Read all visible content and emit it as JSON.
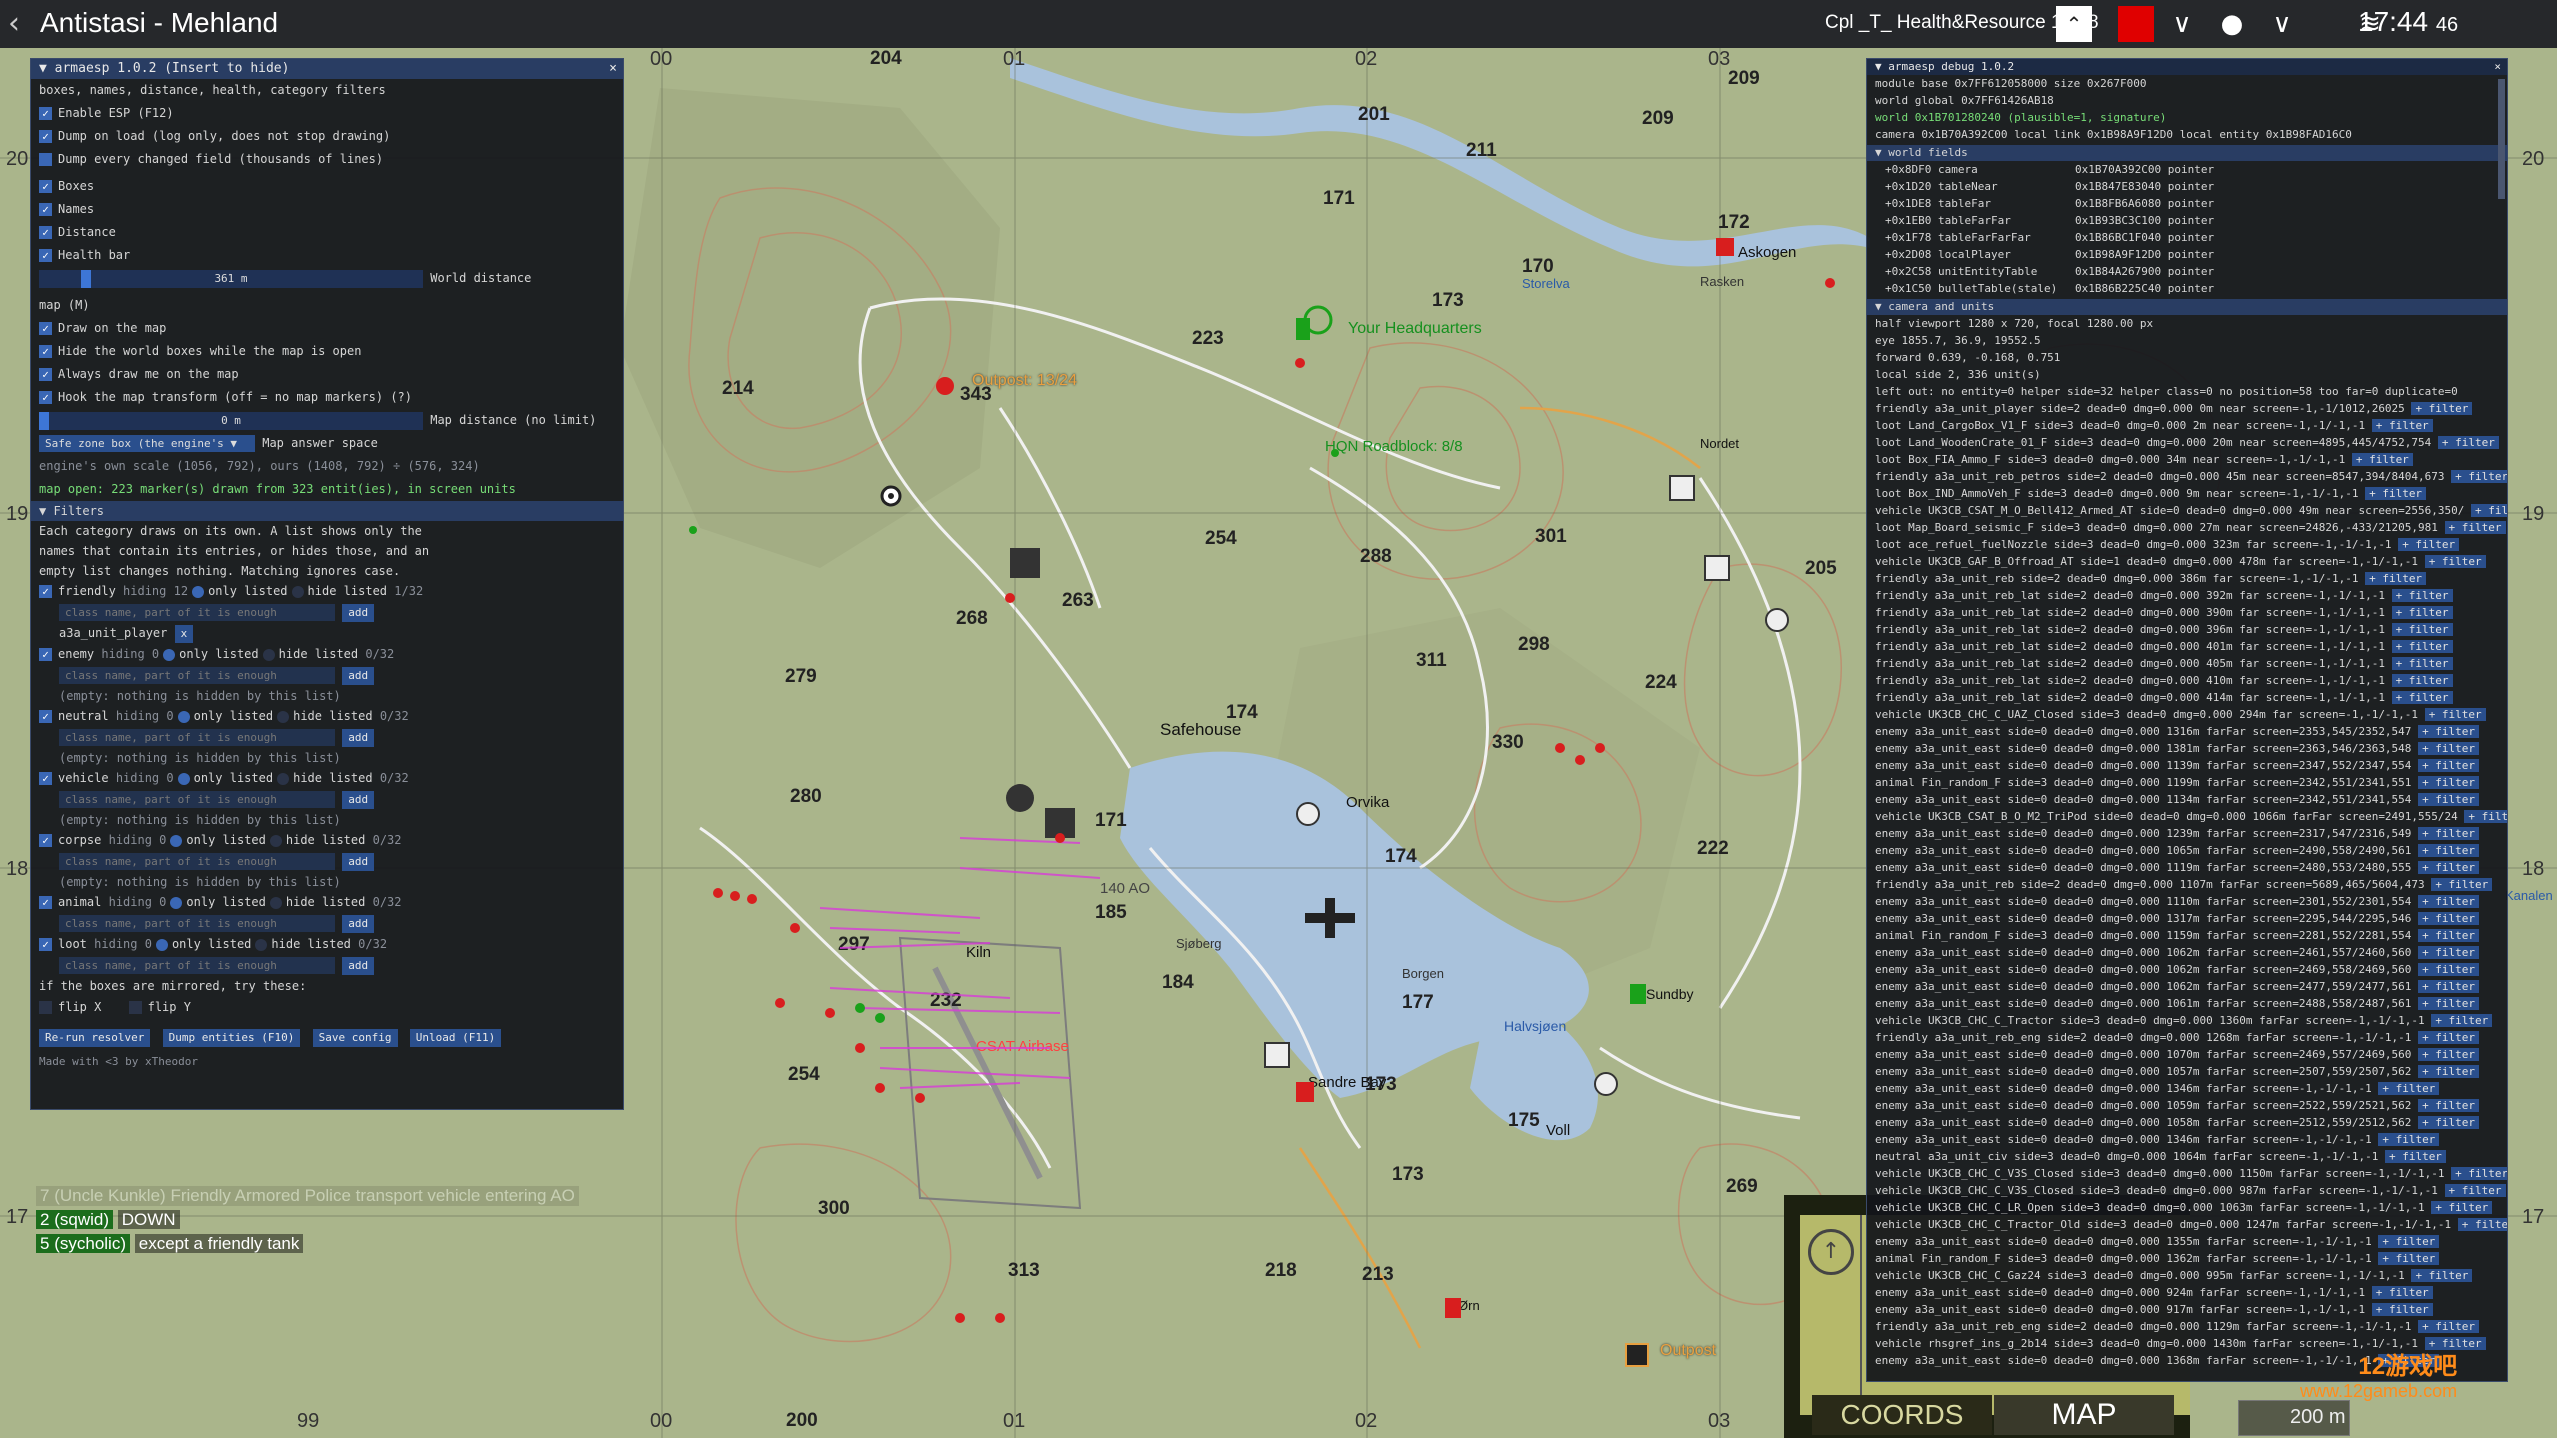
{
  "topbar": {
    "title": "Antistasi - Mehland",
    "unit": "Cpl _T_ Health&Resource 140 8",
    "time": "17:44",
    "seconds": "46"
  },
  "coords_panel": {
    "tab_coords": "COORDS",
    "tab_map": "MAP",
    "scale": "200 m"
  },
  "grid": {
    "top": [
      "00",
      "01",
      "02",
      "03"
    ],
    "bottom": [
      "99",
      "00",
      "01",
      "02",
      "03"
    ],
    "left": [
      "20",
      "19",
      "18",
      "17"
    ],
    "right": [
      "20",
      "19",
      "18",
      "17"
    ]
  },
  "map_labels": {
    "heights": [
      "204",
      "201",
      "209",
      "209",
      "211",
      "171",
      "172",
      "170",
      "173",
      "223",
      "214",
      "343",
      "254",
      "288",
      "301",
      "205",
      "268",
      "263",
      "311",
      "298",
      "224",
      "279",
      "174",
      "330",
      "280",
      "171",
      "174",
      "222",
      "185",
      "184",
      "177",
      "232",
      "297",
      "173",
      "175",
      "254",
      "300",
      "173",
      "218",
      "213",
      "313",
      "200",
      "269"
    ],
    "places": [
      "Outpost: 13/24",
      "Your Headquarters",
      "HQN Roadblock: 8/8",
      "Safehouse",
      "Orvika",
      "140 AO",
      "Sandre Bay",
      "Sundby",
      "Halvsjøen",
      "Voll",
      "Kiln",
      "CSAT Airbase",
      "Rasken",
      "Storelva",
      "Sjøberg",
      "Borgen",
      "Ørn",
      "Outpost",
      "Kanalen",
      "Askogen",
      "Nordet"
    ]
  },
  "chat": [
    {
      "num": "7",
      "who": "(Uncle Kunkle)",
      "text": "Friendly Armored Police transport vehicle entering AO"
    },
    {
      "num": "2",
      "who": "(sqwid)",
      "text": "DOWN"
    },
    {
      "num": "5",
      "who": "(sycholic)",
      "text": "except a friendly tank"
    }
  ],
  "esp": {
    "title": "armaesp 1.0.2 (Insert to hide)",
    "close": "×",
    "subtitle": "boxes, names, distance, health, category filters",
    "opts1": [
      "Enable ESP (F12)",
      "Dump on load (log only, does not stop drawing)",
      "Dump every changed field (thousands of lines)"
    ],
    "opts2": [
      "Boxes",
      "Names",
      "Distance",
      "Health bar"
    ],
    "world_distance_value": "361 m",
    "world_distance_label": "World distance",
    "map_header": "map (M)",
    "opts3": [
      "Draw on the map",
      "Hide the world boxes while the map is open",
      "Always draw me on the map",
      "Hook the map transform (off = no map markers) (?)"
    ],
    "map_distance_value": "0 m",
    "map_distance_label": "Map distance (no limit)",
    "safe_zone": "Safe zone box (the engine's",
    "map_answer": "Map answer space",
    "engine_info": "engine's own scale (1056, 792), ours (1408, 792) ÷ (576, 324)",
    "map_info": "map open: 223 marker(s) drawn from 323 entit(ies), in screen units",
    "filters_header": "Filters",
    "filters_desc": [
      "Each category draws on its own. A list shows only the",
      "names that contain its entries, or hides those, and an",
      "empty list changes nothing. Matching ignores case."
    ],
    "placeholder": "class name, part of it is enough",
    "add": "add",
    "empty_note": "(empty: nothing is hidden by this list)",
    "cats": [
      {
        "name": "friendly",
        "hiding": "hiding 12",
        "count": "1/32",
        "tag": "a3a_unit_player"
      },
      {
        "name": "enemy",
        "hiding": "hiding 0",
        "count": "0/32"
      },
      {
        "name": "neutral",
        "hiding": "hiding 0",
        "count": "0/32"
      },
      {
        "name": "vehicle",
        "hiding": "hiding 0",
        "count": "0/32"
      },
      {
        "name": "corpse",
        "hiding": "hiding 0",
        "count": "0/32"
      },
      {
        "name": "animal",
        "hiding": "hiding 0",
        "count": "0/32"
      },
      {
        "name": "loot",
        "hiding": "hiding 0",
        "count": "0/32"
      }
    ],
    "only_listed": "only listed",
    "hide_listed": "hide listed",
    "mirror_note": "if the boxes are mirrored, try these:",
    "flipx": "flip X",
    "flipy": "flip Y",
    "buttons": [
      "Re-run resolver",
      "Dump entities (F10)",
      "Save config",
      "Unload (F11)"
    ],
    "footer": "Made with <3 by xTheodor"
  },
  "debug": {
    "title": "armaesp debug 1.0.2",
    "close": "×",
    "lines": [
      "module base 0x7FF612058000  size 0x267F000",
      "world global 0x7FF61426AB18",
      "world 0x1B701280240 (plausible=1, signature)",
      "camera 0x1B70A392C00  local link 0x1B98A9F12D0  local entity 0x1B98FAD16C0"
    ],
    "world_fields_header": "world fields",
    "fields": [
      [
        "+0x8DF0 camera",
        "0x1B70A392C00 pointer"
      ],
      [
        "+0x1D20 tableNear",
        "0x1B847E83040 pointer"
      ],
      [
        "+0x1DE8 tableFar",
        "0x1B8FB6A6080 pointer"
      ],
      [
        "+0x1EB0 tableFarFar",
        "0x1B93BC3C100 pointer"
      ],
      [
        "+0x1F78 tableFarFarFar",
        "0x1B86BC1F040 pointer"
      ],
      [
        "+0x2D08 localPlayer",
        "0x1B98A9F12D0 pointer"
      ],
      [
        "+0x2C58 unitEntityTable",
        "0x1B84A267900 pointer"
      ],
      [
        "+0x1C50 bulletTable(stale)",
        "0x1B86B225C40 pointer"
      ]
    ],
    "camera_header": "camera and units",
    "cam_lines": [
      "half viewport 1280 x 720, focal 1280.00 px",
      "eye 1855.7, 36.9, 19552.5",
      "forward 0.639, -0.168, 0.751",
      "local side 2, 336 unit(s)",
      "left out: no entity=0 helper side=32 helper class=0 no position=58 too far=0 duplicate=0"
    ],
    "filter_tag": "+ filter",
    "units": [
      "friendly a3a_unit_player side=2 dead=0 dmg=0.000 0m near screen=-1,-1/1012,26025",
      "loot Land_CargoBox_V1_F side=3 dead=0 dmg=0.000 2m near screen=-1,-1/-1,-1",
      "loot Land_WoodenCrate_01_F side=3 dead=0 dmg=0.000 20m near screen=4895,445/4752,754",
      "loot Box_FIA_Ammo_F side=3 dead=0 dmg=0.000 34m near screen=-1,-1/-1,-1",
      "friendly a3a_unit_reb_petros side=2 dead=0 dmg=0.000 45m near screen=8547,394/8404,673",
      "loot Box_IND_AmmoVeh_F side=3 dead=0 dmg=0.000 9m near screen=-1,-1/-1,-1",
      "vehicle UK3CB_CSAT_M_O_Bell412_Armed_AT side=0 dead=0 dmg=0.000 49m near screen=2556,350/",
      "loot Map_Board_seismic_F side=3 dead=0 dmg=0.000 27m near screen=24826,-433/21205,981",
      "loot ace_refuel_fuelNozzle side=3 dead=0 dmg=0.000 323m far screen=-1,-1/-1,-1",
      "vehicle UK3CB_GAF_B_Offroad_AT side=1 dead=0 dmg=0.000 478m far screen=-1,-1/-1,-1",
      "friendly a3a_unit_reb side=2 dead=0 dmg=0.000 386m far screen=-1,-1/-1,-1",
      "friendly a3a_unit_reb_lat side=2 dead=0 dmg=0.000 392m far screen=-1,-1/-1,-1",
      "friendly a3a_unit_reb_lat side=2 dead=0 dmg=0.000 390m far screen=-1,-1/-1,-1",
      "friendly a3a_unit_reb_lat side=2 dead=0 dmg=0.000 396m far screen=-1,-1/-1,-1",
      "friendly a3a_unit_reb_lat side=2 dead=0 dmg=0.000 401m far screen=-1,-1/-1,-1",
      "friendly a3a_unit_reb_lat side=2 dead=0 dmg=0.000 405m far screen=-1,-1/-1,-1",
      "friendly a3a_unit_reb_lat side=2 dead=0 dmg=0.000 410m far screen=-1,-1/-1,-1",
      "friendly a3a_unit_reb_lat side=2 dead=0 dmg=0.000 414m far screen=-1,-1/-1,-1",
      "vehicle UK3CB_CHC_C_UAZ_Closed side=3 dead=0 dmg=0.000 294m far screen=-1,-1/-1,-1",
      "enemy a3a_unit_east side=0 dead=0 dmg=0.000 1316m farFar screen=2353,545/2352,547",
      "enemy a3a_unit_east side=0 dead=0 dmg=0.000 1381m farFar screen=2363,546/2363,548",
      "enemy a3a_unit_east side=0 dead=0 dmg=0.000 1139m farFar screen=2347,552/2347,554",
      "animal Fin_random_F side=3 dead=0 dmg=0.000 1199m farFar screen=2342,551/2341,551",
      "enemy a3a_unit_east side=0 dead=0 dmg=0.000 1134m farFar screen=2342,551/2341,554",
      "vehicle UK3CB_CSAT_B_O_M2_TriPod side=0 dead=0 dmg=0.000 1066m farFar screen=2491,555/24",
      "enemy a3a_unit_east side=0 dead=0 dmg=0.000 1239m farFar screen=2317,547/2316,549",
      "enemy a3a_unit_east side=0 dead=0 dmg=0.000 1065m farFar screen=2490,558/2490,561",
      "enemy a3a_unit_east side=0 dead=0 dmg=0.000 1119m farFar screen=2480,553/2480,555",
      "friendly a3a_unit_reb side=2 dead=0 dmg=0.000 1107m farFar screen=5689,465/5604,473",
      "enemy a3a_unit_east side=0 dead=0 dmg=0.000 1110m farFar screen=2301,552/2301,554",
      "enemy a3a_unit_east side=0 dead=0 dmg=0.000 1317m farFar screen=2295,544/2295,546",
      "animal Fin_random_F side=3 dead=0 dmg=0.000 1159m farFar screen=2281,552/2281,554",
      "enemy a3a_unit_east side=0 dead=0 dmg=0.000 1062m farFar screen=2461,557/2460,560",
      "enemy a3a_unit_east side=0 dead=0 dmg=0.000 1062m farFar screen=2469,558/2469,560",
      "enemy a3a_unit_east side=0 dead=0 dmg=0.000 1062m farFar screen=2477,559/2477,561",
      "enemy a3a_unit_east side=0 dead=0 dmg=0.000 1061m farFar screen=2488,558/2487,561",
      "vehicle UK3CB_CHC_C_Tractor side=3 dead=0 dmg=0.000 1360m farFar screen=-1,-1/-1,-1",
      "friendly a3a_unit_reb_eng side=2 dead=0 dmg=0.000 1268m farFar screen=-1,-1/-1,-1",
      "enemy a3a_unit_east side=0 dead=0 dmg=0.000 1070m farFar screen=2469,557/2469,560",
      "enemy a3a_unit_east side=0 dead=0 dmg=0.000 1057m farFar screen=2507,559/2507,562",
      "enemy a3a_unit_east side=0 dead=0 dmg=0.000 1346m farFar screen=-1,-1/-1,-1",
      "enemy a3a_unit_east side=0 dead=0 dmg=0.000 1059m farFar screen=2522,559/2521,562",
      "enemy a3a_unit_east side=0 dead=0 dmg=0.000 1058m farFar screen=2512,559/2512,562",
      "enemy a3a_unit_east side=0 dead=0 dmg=0.000 1346m farFar screen=-1,-1/-1,-1",
      "neutral a3a_unit_civ side=3 dead=0 dmg=0.000 1064m farFar screen=-1,-1/-1,-1",
      "vehicle UK3CB_CHC_C_V3S_Closed side=3 dead=0 dmg=0.000 1150m farFar screen=-1,-1/-1,-1",
      "vehicle UK3CB_CHC_C_V3S_Closed side=3 dead=0 dmg=0.000 987m farFar screen=-1,-1/-1,-1",
      "vehicle UK3CB_CHC_C_LR_Open side=3 dead=0 dmg=0.000 1063m farFar screen=-1,-1/-1,-1",
      "vehicle UK3CB_CHC_C_Tractor_Old side=3 dead=0 dmg=0.000 1247m farFar screen=-1,-1/-1,-1",
      "enemy a3a_unit_east side=0 dead=0 dmg=0.000 1355m farFar screen=-1,-1/-1,-1",
      "animal Fin_random_F side=3 dead=0 dmg=0.000 1362m farFar screen=-1,-1/-1,-1",
      "vehicle UK3CB_CHC_C_Gaz24 side=3 dead=0 dmg=0.000 995m farFar screen=-1,-1/-1,-1",
      "enemy a3a_unit_east side=0 dead=0 dmg=0.000 924m farFar screen=-1,-1/-1,-1",
      "enemy a3a_unit_east side=0 dead=0 dmg=0.000 917m farFar screen=-1,-1/-1,-1",
      "friendly a3a_unit_reb_eng side=2 dead=0 dmg=0.000 1129m farFar screen=-1,-1/-1,-1",
      "vehicle rhsgref_ins_g_2b14 side=3 dead=0 dmg=0.000 1430m farFar screen=-1,-1/-1,-1",
      "enemy a3a_unit_east side=0 dead=0 dmg=0.000 1368m farFar screen=-1,-1/-1,-1"
    ]
  },
  "watermark": {
    "site": "12游戏吧",
    "url": "www.12gameb.com"
  },
  "colors": {
    "map": "#aab58b",
    "water": "#a9c2dc",
    "panel_title": "#293d63",
    "checkbox": "#3a67b5",
    "topbar": "#26282b",
    "marker_red": "#d81e1e",
    "marker_green": "#1aa11a"
  }
}
